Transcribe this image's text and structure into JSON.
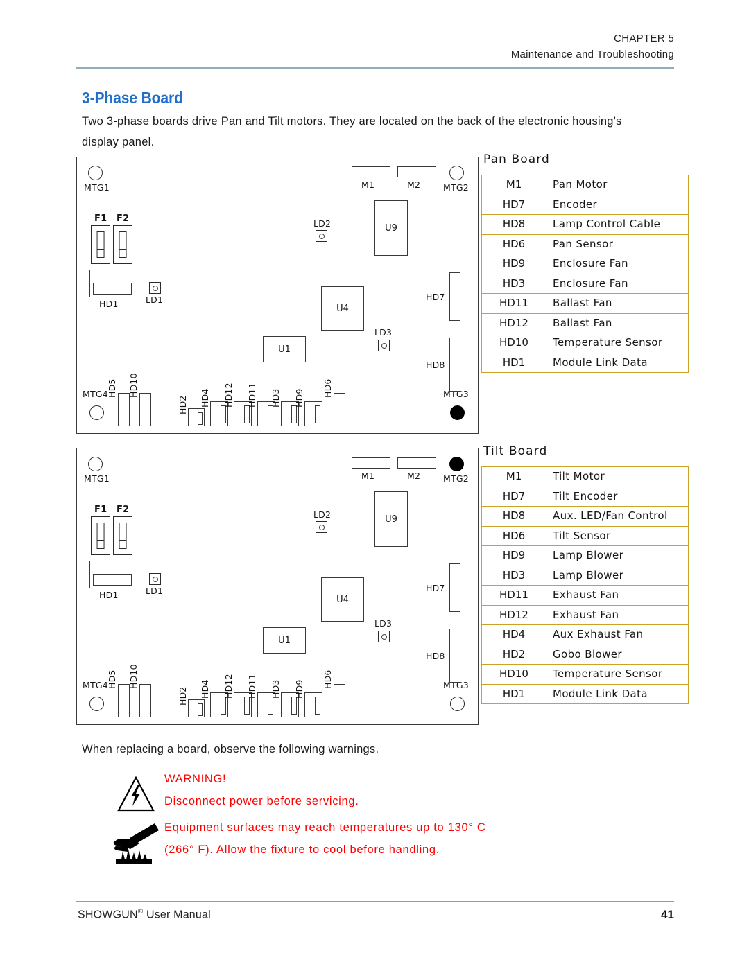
{
  "header": {
    "chapter": "CHAPTER 5",
    "subtitle": "Maintenance and Troubleshooting",
    "rule_color": "#8FAEB8"
  },
  "section": {
    "title": "3-Phase Board",
    "title_color": "#1F6FCB",
    "intro": "Two 3-phase boards drive Pan and Tilt motors. They are located on the back of the electronic housing's display panel."
  },
  "boards": {
    "pan": {
      "name": "Pan Board",
      "mounting_holes": [
        {
          "label": "MTG1",
          "filled": false
        },
        {
          "label": "MTG2",
          "filled": false
        },
        {
          "label": "MTG3",
          "filled": true
        },
        {
          "label": "MTG4",
          "filled": false
        }
      ],
      "fuses": [
        "F1",
        "F2"
      ],
      "leds": [
        "LD1",
        "LD2",
        "LD3"
      ],
      "chips": [
        "U9",
        "U4",
        "U1"
      ],
      "motor_connectors": [
        "M1",
        "M2"
      ],
      "edge_connectors": [
        "HD7",
        "HD8"
      ],
      "header_connector": "HD1",
      "bottom_connectors": [
        "HD5",
        "HD10",
        "HD2",
        "HD4",
        "HD12",
        "HD11",
        "HD3",
        "HD9",
        "HD6"
      ]
    },
    "tilt": {
      "name": "Tilt Board",
      "mounting_holes": [
        {
          "label": "MTG1",
          "filled": false
        },
        {
          "label": "MTG2",
          "filled": true
        },
        {
          "label": "MTG3",
          "filled": false
        },
        {
          "label": "MTG4",
          "filled": false
        }
      ],
      "fuses": [
        "F1",
        "F2"
      ],
      "leds": [
        "LD1",
        "LD2",
        "LD3"
      ],
      "chips": [
        "U9",
        "U4",
        "U1"
      ],
      "motor_connectors": [
        "M1",
        "M2"
      ],
      "edge_connectors": [
        "HD7",
        "HD8"
      ],
      "header_connector": "HD1",
      "bottom_connectors": [
        "HD5",
        "HD10",
        "HD2",
        "HD4",
        "HD12",
        "HD11",
        "HD3",
        "HD9",
        "HD6"
      ]
    }
  },
  "tables": {
    "border_color": "#C9A227",
    "pan": {
      "title": "Pan Board",
      "rows": [
        {
          "ref": "M1",
          "desc": "Pan Motor"
        },
        {
          "ref": "HD7",
          "desc": "Encoder"
        },
        {
          "ref": "HD8",
          "desc": "Lamp Control Cable"
        },
        {
          "ref": "HD6",
          "desc": "Pan Sensor"
        },
        {
          "ref": "HD9",
          "desc": "Enclosure Fan"
        },
        {
          "ref": "HD3",
          "desc": "Enclosure Fan"
        },
        {
          "ref": "HD11",
          "desc": "Ballast Fan"
        },
        {
          "ref": "HD12",
          "desc": "Ballast Fan"
        },
        {
          "ref": "HD10",
          "desc": "Temperature Sensor"
        },
        {
          "ref": "HD1",
          "desc": "Module Link Data"
        }
      ]
    },
    "tilt": {
      "title": "Tilt Board",
      "rows": [
        {
          "ref": "M1",
          "desc": "Tilt Motor"
        },
        {
          "ref": "HD7",
          "desc": "Tilt Encoder"
        },
        {
          "ref": "HD8",
          "desc": "Aux. LED/Fan Control"
        },
        {
          "ref": "HD6",
          "desc": "Tilt Sensor"
        },
        {
          "ref": "HD9",
          "desc": "Lamp Blower"
        },
        {
          "ref": "HD3",
          "desc": "Lamp Blower"
        },
        {
          "ref": "HD11",
          "desc": "Exhaust Fan"
        },
        {
          "ref": "HD12",
          "desc": "Exhaust Fan"
        },
        {
          "ref": "HD4",
          "desc": "Aux Exhaust Fan"
        },
        {
          "ref": "HD2",
          "desc": "Gobo Blower"
        },
        {
          "ref": "HD10",
          "desc": "Temperature Sensor"
        },
        {
          "ref": "HD1",
          "desc": "Module Link Data"
        }
      ]
    }
  },
  "warnings": {
    "intro": "When replacing a board, observe the following warnings.",
    "color": "#FF0000",
    "electrical": {
      "heading": "WARNING!",
      "text": "Disconnect power before servicing."
    },
    "heat": {
      "line1": "Equipment surfaces may reach temperatures up to 130° C",
      "line2": "(266° F). Allow the fixture to cool before handling."
    }
  },
  "footer": {
    "manual": "SHOWGUN",
    "manual_mark": "®",
    "manual_suffix": " User Manual",
    "page": "41"
  }
}
